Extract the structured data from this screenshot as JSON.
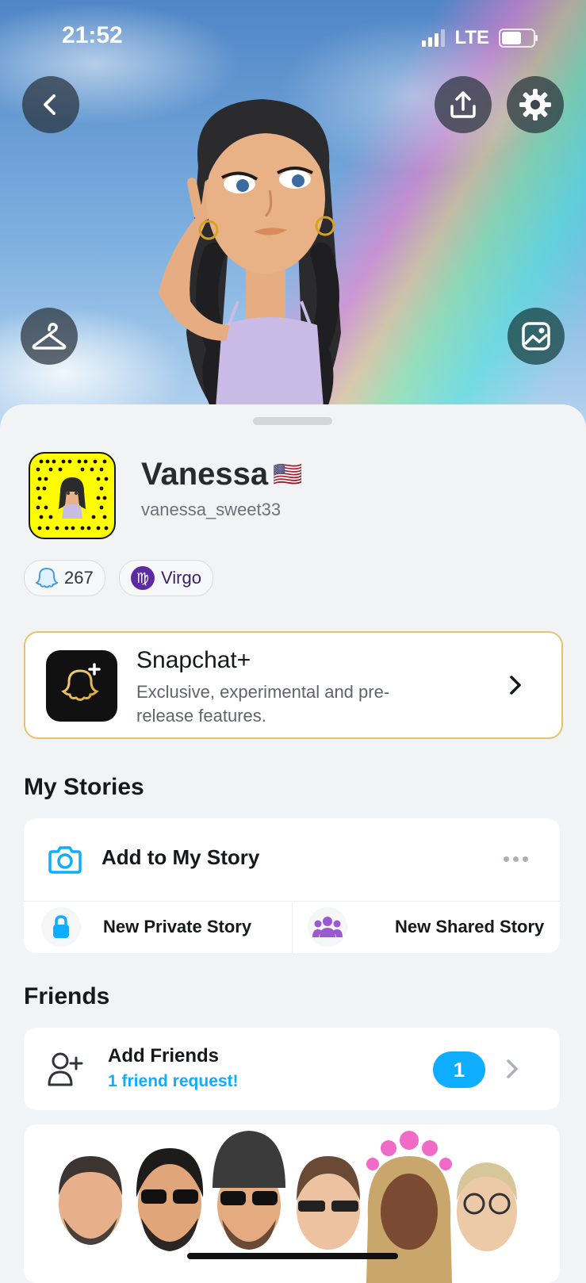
{
  "status_bar": {
    "time": "21:52",
    "network": "LTE"
  },
  "profile": {
    "display_name": "Vanessa",
    "flag": "🇺🇸",
    "username": "vanessa_sweet33",
    "snap_score": "267",
    "zodiac": "Virgo",
    "zodiac_symbol": "♍"
  },
  "snapchat_plus": {
    "title": "Snapchat+",
    "description": "Exclusive, experimental and pre-release features."
  },
  "my_stories": {
    "title": "My Stories",
    "add_label": "Add to My Story",
    "private_label": "New Private Story",
    "shared_label": "New Shared Story"
  },
  "friends": {
    "title": "Friends",
    "add_label": "Add Friends",
    "request_text": "1 friend request!",
    "badge_count": "1"
  },
  "colors": {
    "snap_yellow": "#fffc00",
    "accent_blue": "#0fadff",
    "zodiac_purple": "#5b2aa4",
    "private_blue": "#0fadff",
    "shared_purple": "#9b59d0"
  }
}
